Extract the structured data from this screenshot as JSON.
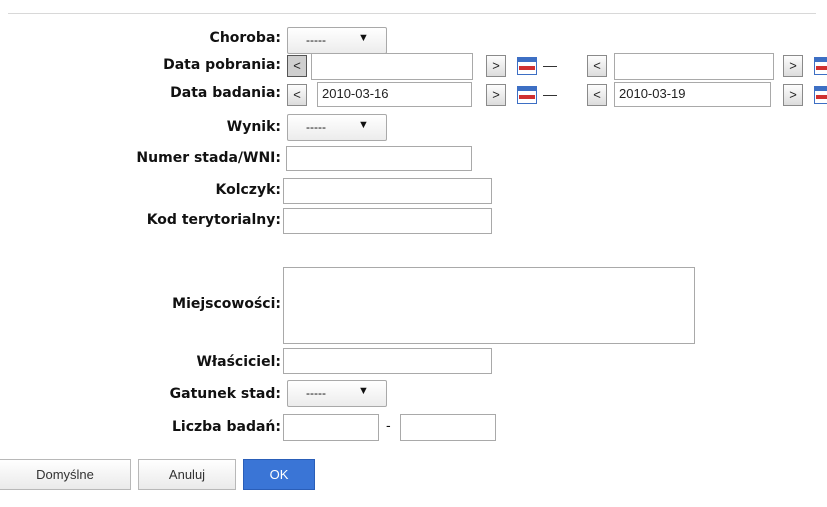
{
  "form": {
    "choroba": {
      "label": "Choroba:",
      "value": "-----"
    },
    "data_pobrania": {
      "label": "Data pobrania:",
      "from_value": "",
      "to_value": ""
    },
    "data_badania": {
      "label": "Data badania:",
      "from_value": "2010-03-16",
      "to_value": "2010-03-19"
    },
    "wynik": {
      "label": "Wynik:",
      "value": "-----"
    },
    "numer_stada": {
      "label": "Numer stada/WNI:",
      "value": ""
    },
    "kolczyk": {
      "label": "Kolczyk:",
      "value": ""
    },
    "kod_terytorialny": {
      "label": "Kod terytorialny:",
      "value": ""
    },
    "miejscowosci": {
      "label": "Miejscowości:",
      "value": ""
    },
    "wlasciciel": {
      "label": "Właściciel:",
      "value": ""
    },
    "gatunek_stad": {
      "label": "Gatunek stad:",
      "value": "-----"
    },
    "liczba_badan": {
      "label": "Liczba badań:",
      "from_value": "",
      "to_value": "",
      "separator": "-"
    }
  },
  "date_nav": {
    "prev": "<",
    "next": ">",
    "range_sep": "—",
    "icon": "calendar-icon"
  },
  "select_icon": "▼",
  "buttons": {
    "default_label": "Domyślne",
    "cancel_label": "Anuluj",
    "ok_label": "OK"
  },
  "colors": {
    "ok_button": "#3a75d6",
    "calendar_red": "#d03030",
    "calendar_blue": "#3d6fc4"
  }
}
